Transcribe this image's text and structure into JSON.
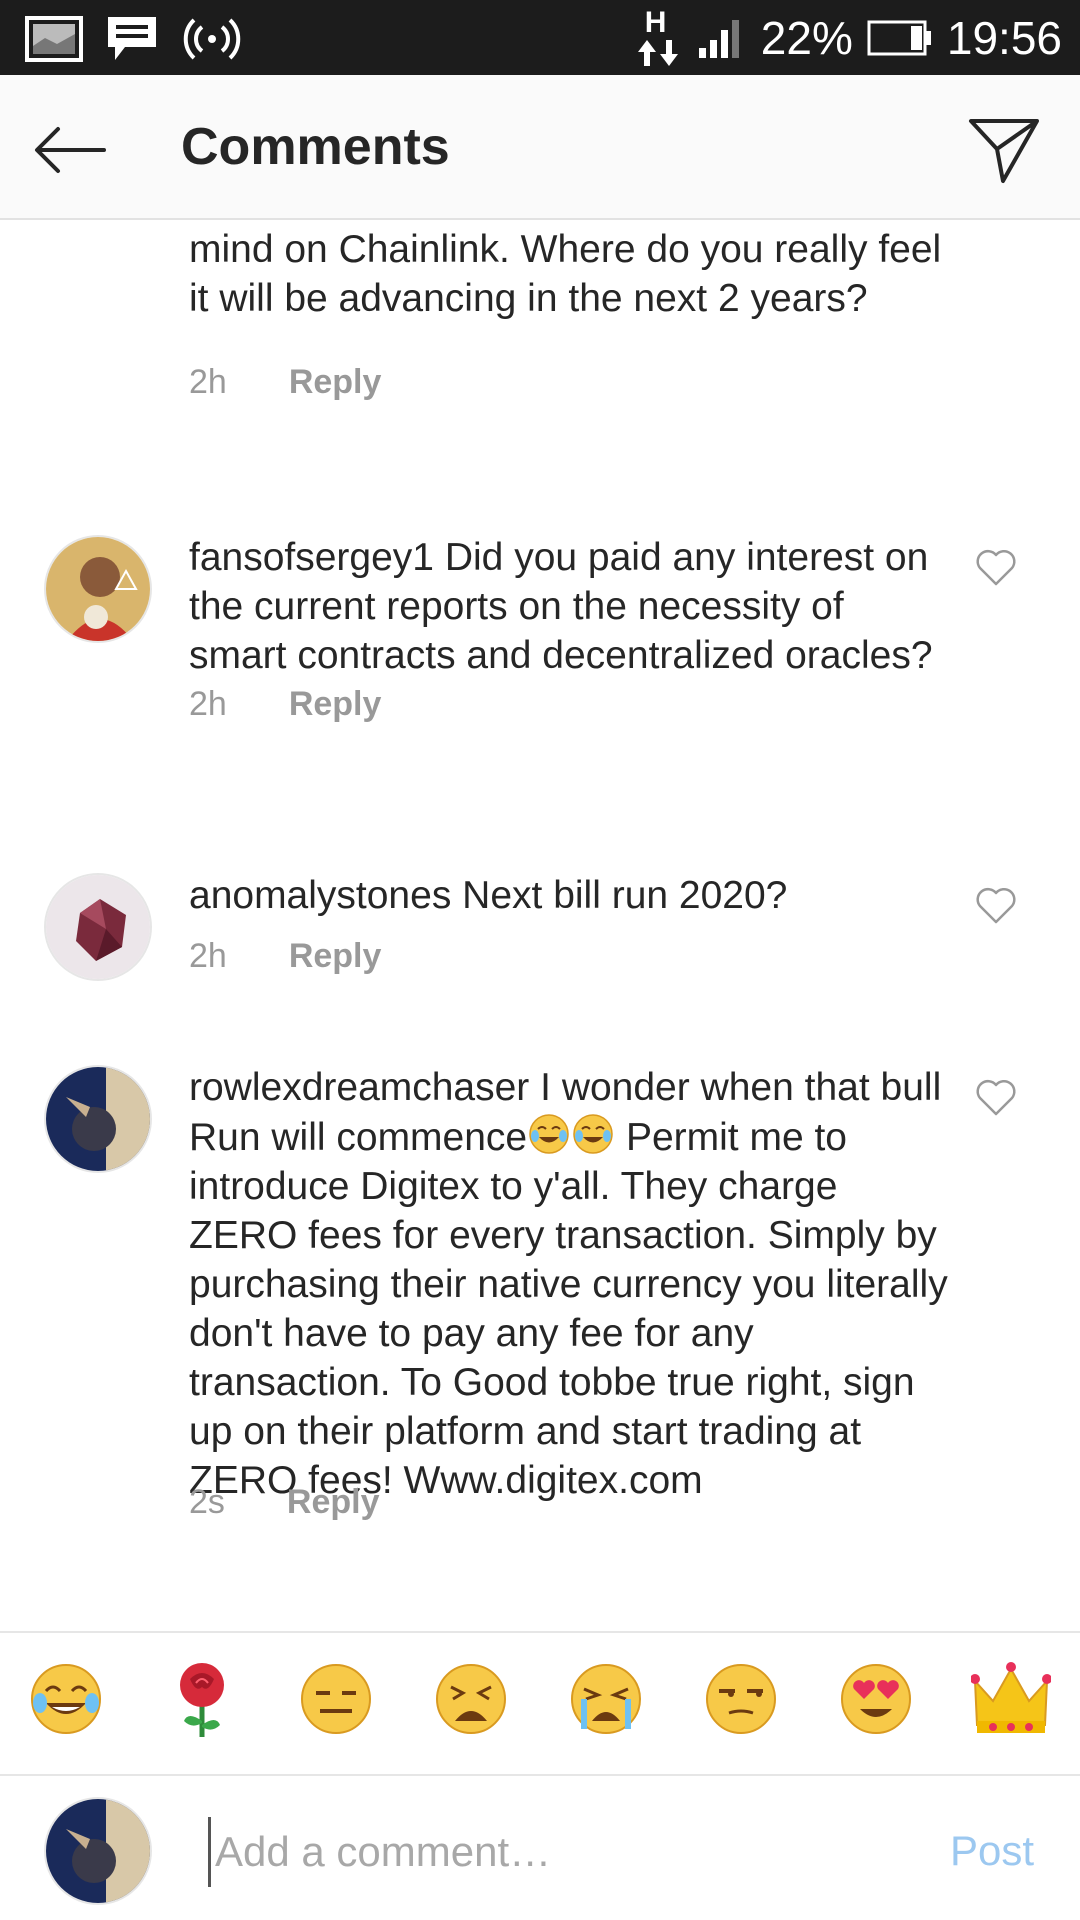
{
  "status_bar": {
    "battery": "22%",
    "time": "19:56",
    "network": "H"
  },
  "header": {
    "title": "Comments"
  },
  "comments": [
    {
      "username": "",
      "text": "mind on Chainlink. Where do you really feel it will be advancing in the next 2 years?",
      "time": "2h",
      "reply_label": "Reply"
    },
    {
      "username": "fansofsergey1",
      "text": "Did you paid any interest on the current reports on the necessity of smart contracts and decentralized oracles?",
      "time": "2h",
      "reply_label": "Reply"
    },
    {
      "username": "anomalystones",
      "text": "Next bill run 2020?",
      "time": "2h",
      "reply_label": "Reply"
    },
    {
      "username": "rowlexdreamchaser",
      "text_before_emoji": "I wonder when that bull Run will commence",
      "text_after_emoji": " Permit me to introduce Digitex to y'all.  They charge ZERO fees for every transaction. Simply by purchasing their native currency you literally don't have to pay any fee for any transaction.  To Good tobbe true right,  sign up on their platform and start trading at ZERO fees! Www.digitex.com",
      "time": "2s",
      "reply_label": "Reply"
    }
  ],
  "emoji_bar": [
    "tears-of-joy",
    "rose",
    "expressionless",
    "weary",
    "loudly-crying",
    "unamused",
    "heart-eyes",
    "crown"
  ],
  "composer": {
    "placeholder": "Add a comment…",
    "post_label": "Post"
  },
  "colors": {
    "status_bar_bg": "#1c1c1c",
    "link_blue_disabled": "#9cc8f0",
    "muted_text": "#999999"
  }
}
